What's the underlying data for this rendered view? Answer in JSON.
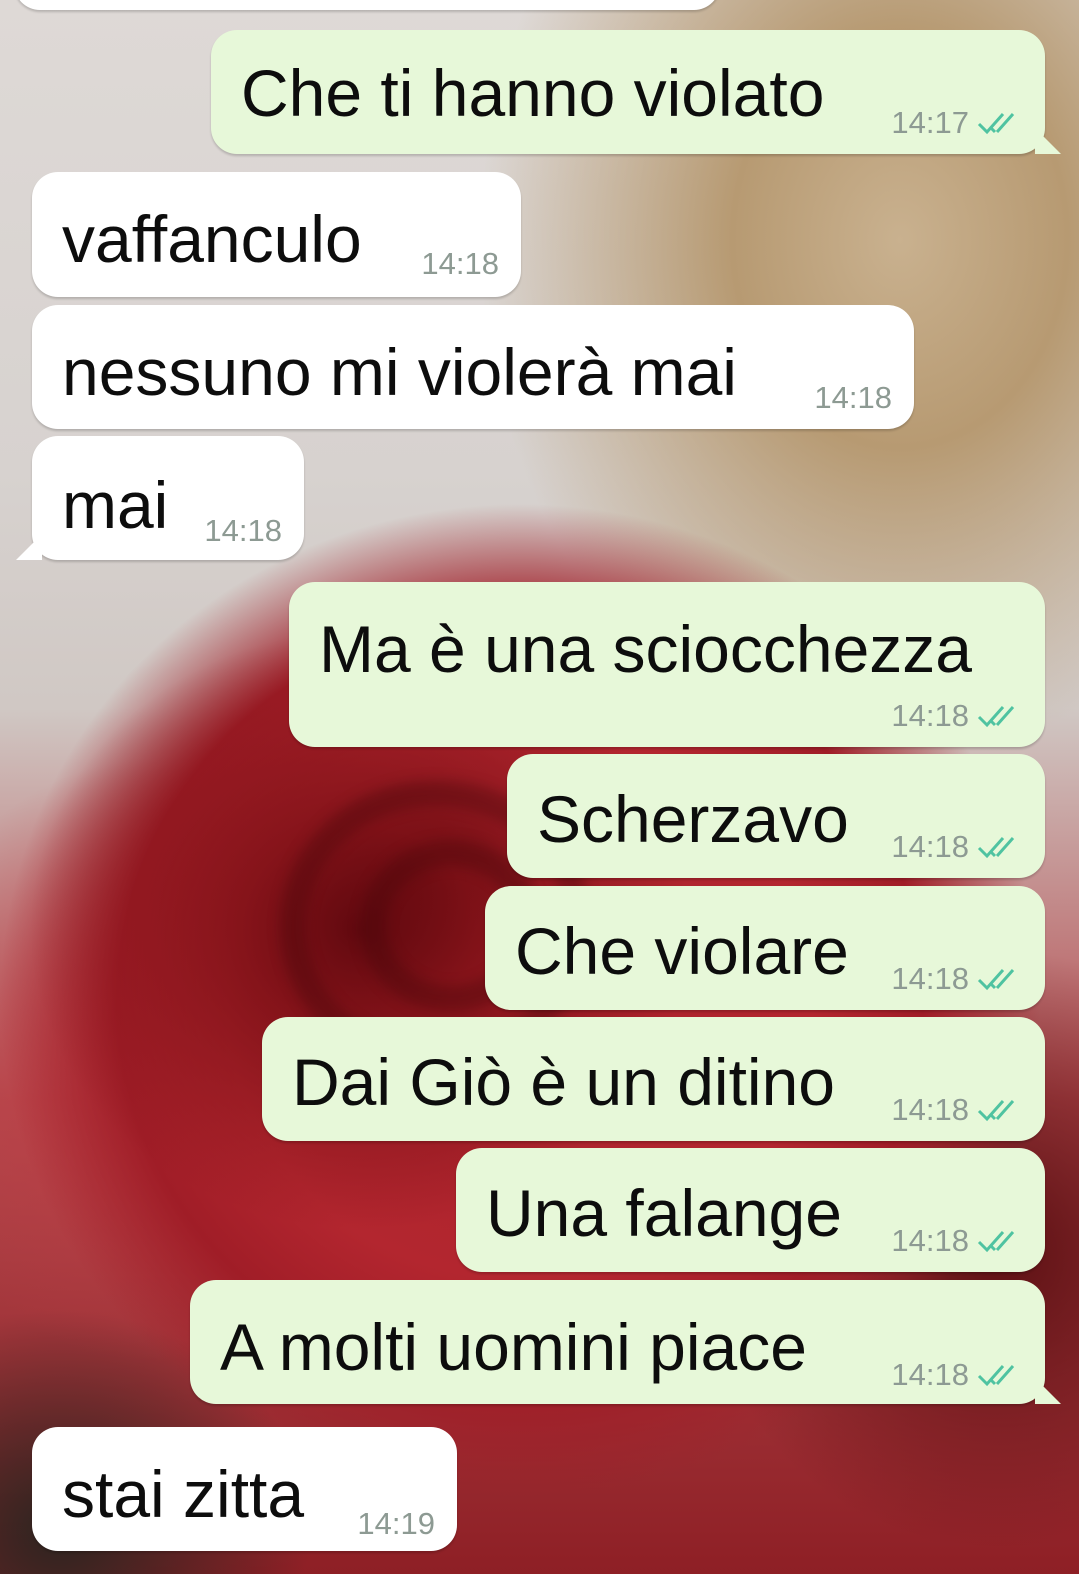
{
  "colors": {
    "outgoing_bubble": "#e7f8d9",
    "incoming_bubble": "#ffffff",
    "read_ticks": "#4fc3a1",
    "timestamp": "#8d9a93"
  },
  "messages": [
    {
      "direction": "outgoing",
      "text": "Che ti hanno violato",
      "time": "14:17",
      "status_icon": "double-check-icon"
    },
    {
      "direction": "incoming",
      "text": "vaffanculo",
      "time": "14:18"
    },
    {
      "direction": "incoming",
      "text": "nessuno mi violerà mai",
      "time": "14:18"
    },
    {
      "direction": "incoming",
      "text": "mai",
      "time": "14:18"
    },
    {
      "direction": "outgoing",
      "text": "Ma è una sciocchezza",
      "time": "14:18",
      "status_icon": "double-check-icon"
    },
    {
      "direction": "outgoing",
      "text": "Scherzavo",
      "time": "14:18",
      "status_icon": "double-check-icon"
    },
    {
      "direction": "outgoing",
      "text": "Che violare",
      "time": "14:18",
      "status_icon": "double-check-icon"
    },
    {
      "direction": "outgoing",
      "text": "Dai Giò è un ditino",
      "time": "14:18",
      "status_icon": "double-check-icon"
    },
    {
      "direction": "outgoing",
      "text": "Una falange",
      "time": "14:18",
      "status_icon": "double-check-icon"
    },
    {
      "direction": "outgoing",
      "text": "A molti uomini piace",
      "time": "14:18",
      "status_icon": "double-check-icon"
    },
    {
      "direction": "incoming",
      "text": "stai zitta",
      "time": "14:19"
    }
  ]
}
